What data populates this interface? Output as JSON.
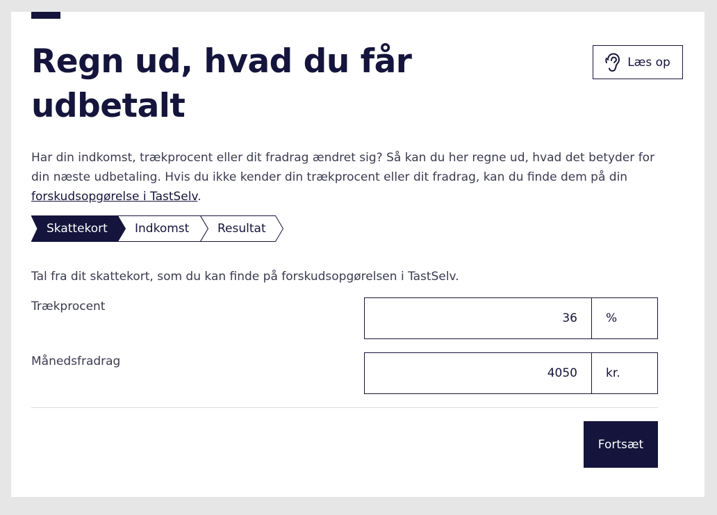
{
  "header": {
    "title": "Regn ud, hvad du får udbetalt",
    "read_aloud_label": "Læs op",
    "read_aloud_icon": "ear-icon"
  },
  "intro": {
    "text": "Har din indkomst, trækprocent eller dit fradrag ændret sig? Så kan du her regne ud, hvad det betyder for din næste udbetaling. Hvis du ikke kender din trækprocent eller dit fradrag, kan du finde dem på din ",
    "link_text": "forskudsopgørelse i TastSelv",
    "suffix": "."
  },
  "steps": [
    {
      "label": "Skattekort",
      "active": true
    },
    {
      "label": "Indkomst",
      "active": false
    },
    {
      "label": "Resultat",
      "active": false
    }
  ],
  "form": {
    "section_text": "Tal fra dit skattekort, som du kan finde på forskudsopgørelsen i TastSelv.",
    "fields": [
      {
        "label": "Trækprocent",
        "value": "36",
        "unit": "%"
      },
      {
        "label": "Månedsfradrag",
        "value": "4050",
        "unit": "kr."
      }
    ]
  },
  "actions": {
    "continue_label": "Fortsæt"
  },
  "colors": {
    "primary": "#14143c",
    "background": "#e6e6e6",
    "card": "#ffffff"
  }
}
